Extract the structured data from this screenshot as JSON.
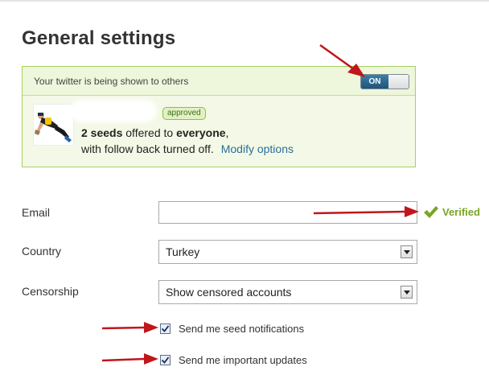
{
  "page": {
    "title": "General settings"
  },
  "twitter_panel": {
    "status_text": "Your twitter is being shown to others",
    "toggle_label": "ON",
    "badge": "approved",
    "seeds_count": "2 seeds",
    "offered_to": "offered to",
    "audience": "everyone",
    "offer_suffix": ",",
    "follow_back_text": "with follow back turned off.",
    "modify_link": "Modify options"
  },
  "form": {
    "email": {
      "label": "Email",
      "value": "",
      "verified_text": "Verified"
    },
    "country": {
      "label": "Country",
      "selected": "Turkey"
    },
    "censorship": {
      "label": "Censorship",
      "selected": "Show censored accounts"
    },
    "checkboxes": [
      {
        "label": "Send me seed notifications",
        "checked": true
      },
      {
        "label": "Send me important updates",
        "checked": true
      }
    ]
  },
  "colors": {
    "panel_border": "#a8cf63",
    "toggle_on": "#1f5478",
    "verified": "#7ba428",
    "link": "#2a6f9a",
    "annotation_arrow": "#c0161c"
  },
  "icons": {
    "verified": "check-icon",
    "dropdown": "chevron-down-icon",
    "avatar": "scuba-diver-avatar",
    "annotation": "red-arrow"
  }
}
